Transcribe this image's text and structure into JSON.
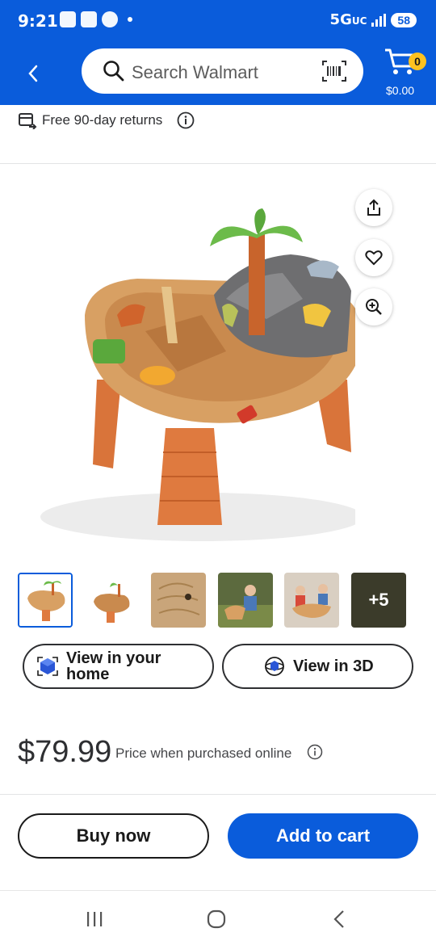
{
  "status_bar": {
    "time": "9:21",
    "network": "5G",
    "network_sub": "UC",
    "battery": "58"
  },
  "header": {
    "search_placeholder": "Search Walmart",
    "cart_count": "0",
    "cart_total": "$0.00"
  },
  "returns": {
    "text": "Free 90-day returns"
  },
  "gallery": {
    "more_label": "+5"
  },
  "view_buttons": {
    "home_line1": "View in your",
    "home_line2": "home",
    "view3d": "View in 3D"
  },
  "price": {
    "amount": "$79.99",
    "note": "Price when purchased online"
  },
  "actions": {
    "buy_now": "Buy now",
    "add_to_cart": "Add to cart"
  },
  "colors": {
    "brand_blue": "#0a5cdb",
    "spark_yellow": "#ffc220"
  },
  "icons": [
    "back-icon",
    "search-icon",
    "barcode-icon",
    "cart-icon",
    "returns-icon",
    "info-icon",
    "share-icon",
    "heart-icon",
    "zoom-icon",
    "ar-cube-icon",
    "3d-icon",
    "recent-apps-icon",
    "home-icon",
    "nav-back-icon"
  ]
}
